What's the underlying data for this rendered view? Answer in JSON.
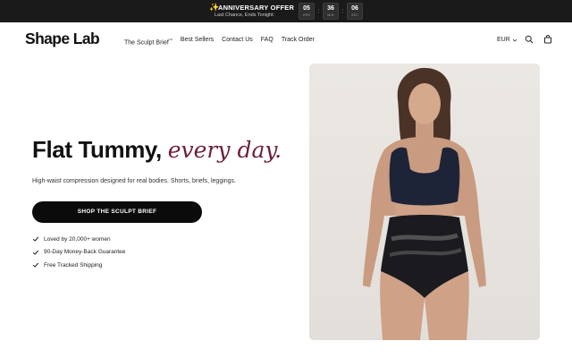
{
  "announcement": {
    "title": "ANNIVERSARY OFFER",
    "subtitle": "Last Chance, Ends Tonight:",
    "timer": [
      {
        "value": "05",
        "unit": "HRS"
      },
      {
        "value": "36",
        "unit": "MIN"
      },
      {
        "value": "06",
        "unit": "SEC"
      }
    ],
    "separator": ":"
  },
  "header": {
    "logo": "Shape Lab",
    "nav": [
      {
        "label": "The Sculpt Brief",
        "mark": "™"
      },
      {
        "label": "Best Sellers"
      },
      {
        "label": "Contact Us"
      },
      {
        "label": "FAQ"
      },
      {
        "label": "Track Order"
      }
    ],
    "currency": "EUR",
    "icons": [
      "chevron-down-icon",
      "search-icon",
      "shopping-bag-icon"
    ]
  },
  "hero": {
    "title_main": "Flat Tummy,",
    "title_accent": "every day.",
    "accent_color": "#6b1e3a",
    "subtitle": "High-waist compression designed for real bodies. Shorts, briefs, leggings.",
    "cta": "SHOP THE SCULPT BRIEF",
    "perks": [
      "Loved by 20,000+ women",
      "90-Day Money-Back Guarantee",
      "Free Tracked Shipping"
    ]
  }
}
